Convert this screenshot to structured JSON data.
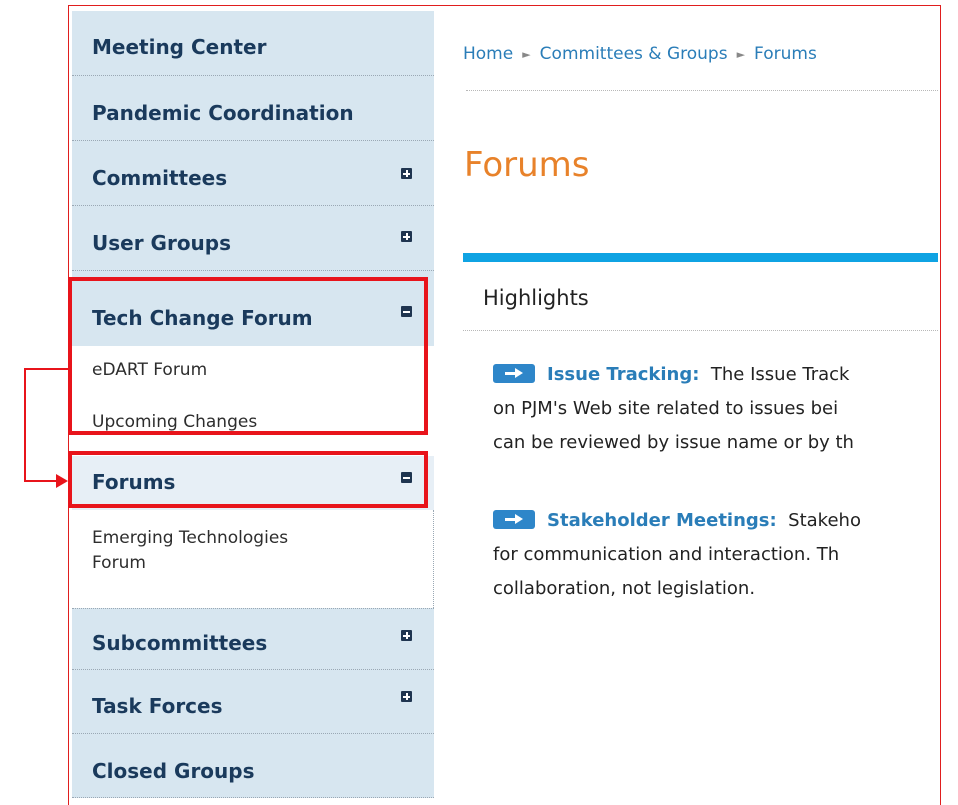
{
  "sidebar": {
    "items": [
      {
        "label": "Meeting Center"
      },
      {
        "label": "Pandemic Coordination"
      },
      {
        "label": "Committees"
      },
      {
        "label": "User Groups"
      },
      {
        "label": "Tech Change Forum",
        "subitems": [
          "eDART Forum",
          "Upcoming Changes"
        ]
      },
      {
        "label": "Forums",
        "subitems": [
          "Emerging Technologies",
          "Forum"
        ]
      },
      {
        "label": "Subcommittees"
      },
      {
        "label": "Task Forces"
      },
      {
        "label": "Closed Groups"
      }
    ]
  },
  "breadcrumb": [
    "Home",
    "Committees & Groups",
    "Forums"
  ],
  "page": {
    "title": "Forums",
    "highlights_heading": "Highlights",
    "highlights": [
      {
        "link": "Issue Tracking:",
        "line1": "The Issue Track",
        "line2": "on PJM's Web site related to issues bei",
        "line3": "can be reviewed by issue name or by th"
      },
      {
        "link": "Stakeholder Meetings:",
        "line1": "Stakeho",
        "line2": "for communication and interaction. Th",
        "line3": "collaboration, not legislation."
      }
    ]
  },
  "colors": {
    "sidebar_bg": "#d7e6f0",
    "nav_text": "#1a3a5c",
    "link": "#2a7db8",
    "title": "#e8822a",
    "highlight_bar": "#0fa3e3",
    "annotation_red": "#e8141b"
  }
}
